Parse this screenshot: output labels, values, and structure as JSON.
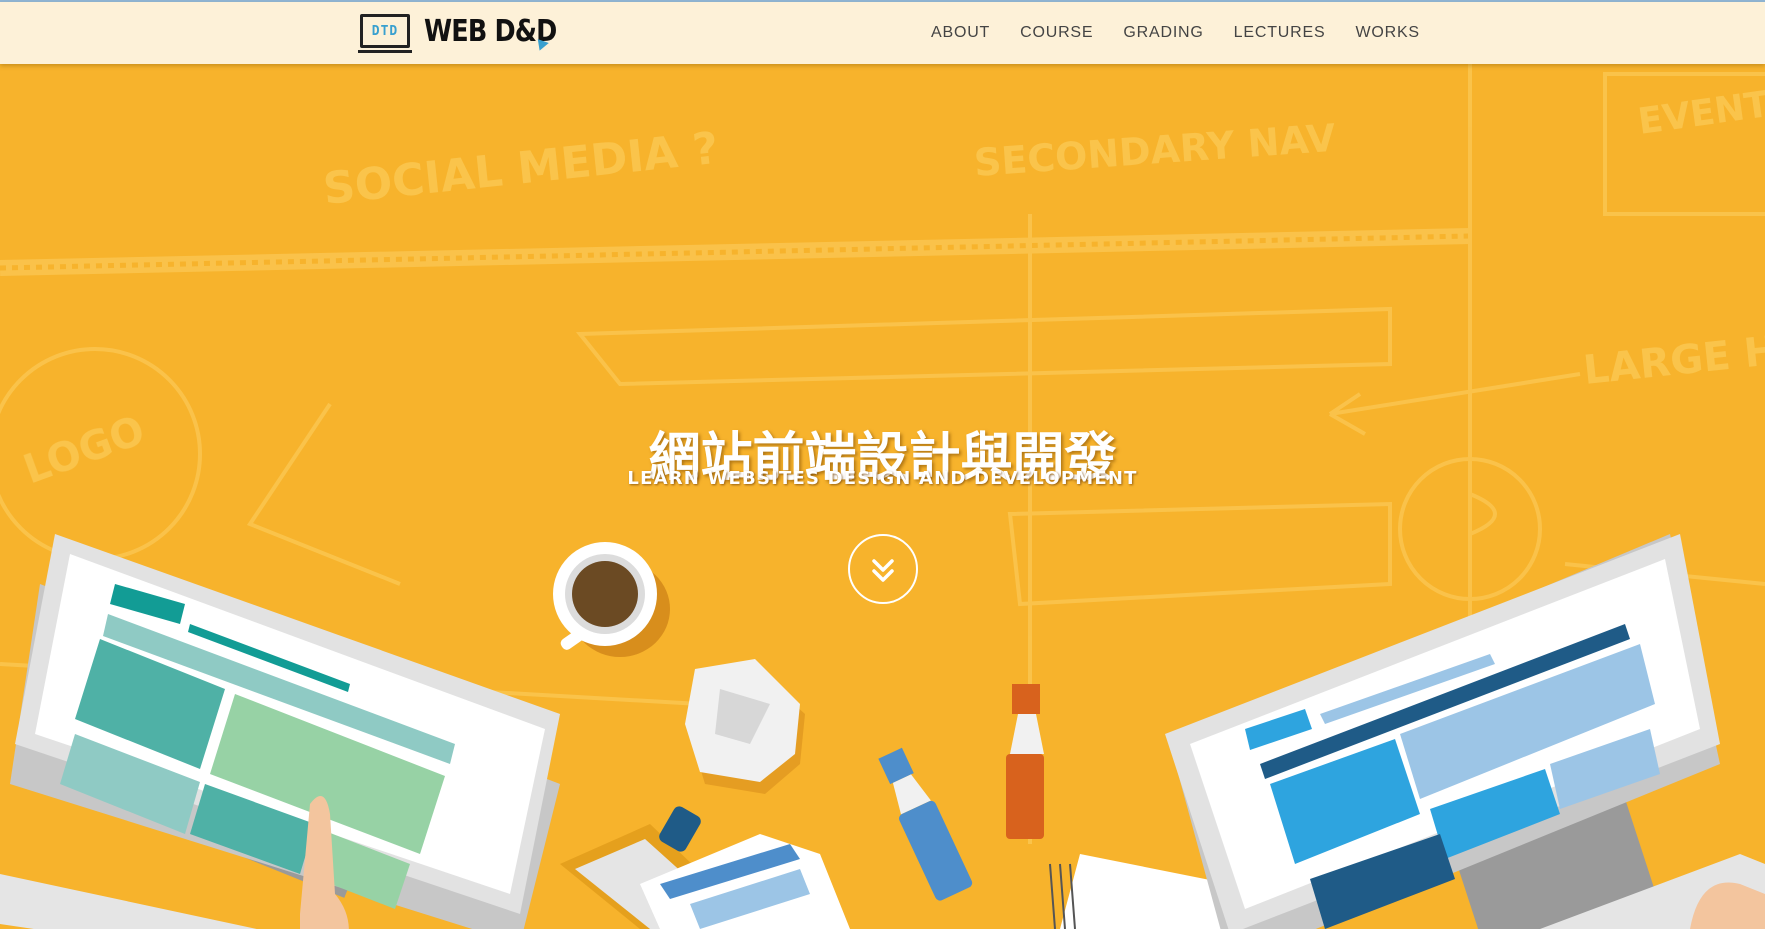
{
  "brand": {
    "mark": "DTD",
    "name": "WEB D&D"
  },
  "nav": {
    "items": [
      {
        "label": "ABOUT"
      },
      {
        "label": "COURSE"
      },
      {
        "label": "GRADING"
      },
      {
        "label": "LECTURES"
      },
      {
        "label": "WORKS"
      }
    ]
  },
  "hero": {
    "title": "網站前端設計與開發",
    "subtitle": "LEARN WEBSITES DESIGN AND DEVELOPMENT",
    "scroll_icon": "chevron-double-down-icon",
    "sketch_words": [
      "SOCIAL MEDIA ?",
      "SECONDARY NAV",
      "LOGO",
      "LARGE HOME BANNER",
      "EVENT"
    ]
  },
  "colors": {
    "background": "#f7b32c",
    "navbar": "#fdf1d8",
    "accent_blue": "#39a0cf",
    "accent_teal": "#4fb1a6"
  }
}
